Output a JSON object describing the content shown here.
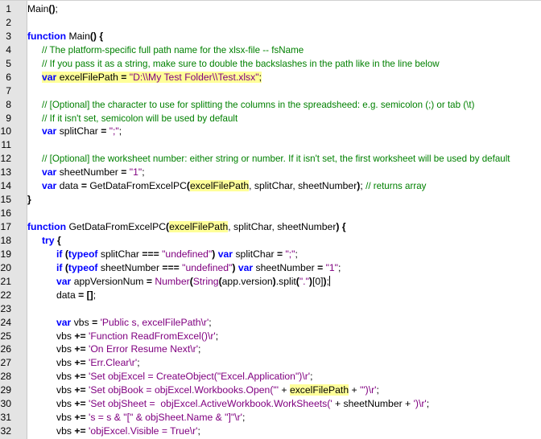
{
  "lines": [
    {
      "n": "1",
      "ind": 0,
      "t": [
        [
          "Main",
          "p"
        ],
        [
          "()",
          "o"
        ],
        [
          ";",
          "p"
        ]
      ]
    },
    {
      "n": "2",
      "ind": 0,
      "t": []
    },
    {
      "n": "3",
      "ind": 0,
      "t": [
        [
          "function",
          "k"
        ],
        [
          " Main",
          "p"
        ],
        [
          "()",
          "o"
        ],
        [
          " {",
          "o"
        ]
      ]
    },
    {
      "n": "4",
      "ind": 1,
      "t": [
        [
          "// The platform-specific full path name for the xlsx-file -- fsName",
          "c"
        ]
      ]
    },
    {
      "n": "5",
      "ind": 1,
      "t": [
        [
          "// If you pass it as a string, make sure to double the backslashes in the path like in the line below",
          "c"
        ]
      ]
    },
    {
      "n": "6",
      "ind": 1,
      "hl": true,
      "t": [
        [
          "var",
          "k"
        ],
        [
          " excelFilePath ",
          "p"
        ],
        [
          "=",
          "o"
        ],
        [
          " ",
          "p"
        ],
        [
          "\"D:\\\\My Test Folder\\\\Test.xlsx\"",
          "s"
        ],
        [
          ";",
          "p"
        ]
      ]
    },
    {
      "n": "7",
      "ind": 0,
      "t": []
    },
    {
      "n": "8",
      "ind": 1,
      "t": [
        [
          "// [Optional] the character to use for splitting the columns in the spreadsheed: e.g. semicolon (;) or tab (\\t)",
          "c"
        ]
      ]
    },
    {
      "n": "9",
      "ind": 1,
      "t": [
        [
          "// If it isn't set, semicolon will be used by default",
          "c"
        ]
      ]
    },
    {
      "n": "10",
      "ind": 1,
      "t": [
        [
          "var",
          "k"
        ],
        [
          " splitChar ",
          "p"
        ],
        [
          "=",
          "o"
        ],
        [
          " ",
          "p"
        ],
        [
          "\";\"",
          "s"
        ],
        [
          ";",
          "p"
        ]
      ]
    },
    {
      "n": "11",
      "ind": 0,
      "t": []
    },
    {
      "n": "12",
      "ind": 1,
      "t": [
        [
          "// [Optional] the worksheet number: either string or number. If it isn't set, the first worksheet will be used by default",
          "c"
        ]
      ]
    },
    {
      "n": "13",
      "ind": 1,
      "t": [
        [
          "var",
          "k"
        ],
        [
          " sheetNumber ",
          "p"
        ],
        [
          "=",
          "o"
        ],
        [
          " ",
          "p"
        ],
        [
          "\"1\"",
          "s"
        ],
        [
          ";",
          "p"
        ]
      ]
    },
    {
      "n": "14",
      "ind": 1,
      "t": [
        [
          "var",
          "k"
        ],
        [
          " data ",
          "p"
        ],
        [
          "=",
          "o"
        ],
        [
          " GetDataFromExcelPC",
          "p"
        ],
        [
          "(",
          "o"
        ],
        [
          "excelFilePath",
          "h"
        ],
        [
          ", splitChar, sheetNumber",
          "p"
        ],
        [
          ")",
          "o"
        ],
        [
          "; ",
          "p"
        ],
        [
          "// returns array",
          "c"
        ]
      ]
    },
    {
      "n": "15",
      "ind": 0,
      "t": [
        [
          "}",
          "o"
        ]
      ]
    },
    {
      "n": "16",
      "ind": 0,
      "t": []
    },
    {
      "n": "17",
      "ind": 0,
      "t": [
        [
          "function",
          "k"
        ],
        [
          " GetDataFromExcelPC",
          "p"
        ],
        [
          "(",
          "o"
        ],
        [
          "excelFilePath",
          "h"
        ],
        [
          ", splitChar, sheetNumber",
          "p"
        ],
        [
          ")",
          "o"
        ],
        [
          " {",
          "o"
        ]
      ]
    },
    {
      "n": "18",
      "ind": 1,
      "t": [
        [
          "try",
          "k"
        ],
        [
          " {",
          "o"
        ]
      ]
    },
    {
      "n": "19",
      "ind": 2,
      "t": [
        [
          "if",
          "k"
        ],
        [
          " (",
          "o"
        ],
        [
          "typeof",
          "k"
        ],
        [
          " splitChar ",
          "p"
        ],
        [
          "===",
          "o"
        ],
        [
          " ",
          "p"
        ],
        [
          "\"undefined\"",
          "s"
        ],
        [
          ")",
          "o"
        ],
        [
          " ",
          "p"
        ],
        [
          "var",
          "k"
        ],
        [
          " splitChar ",
          "p"
        ],
        [
          "=",
          "o"
        ],
        [
          " ",
          "p"
        ],
        [
          "\";\"",
          "s"
        ],
        [
          ";",
          "p"
        ]
      ]
    },
    {
      "n": "20",
      "ind": 2,
      "t": [
        [
          "if",
          "k"
        ],
        [
          " (",
          "o"
        ],
        [
          "typeof",
          "k"
        ],
        [
          " sheetNumber ",
          "p"
        ],
        [
          "===",
          "o"
        ],
        [
          " ",
          "p"
        ],
        [
          "\"undefined\"",
          "s"
        ],
        [
          ")",
          "o"
        ],
        [
          " ",
          "p"
        ],
        [
          "var",
          "k"
        ],
        [
          " sheetNumber ",
          "p"
        ],
        [
          "=",
          "o"
        ],
        [
          " ",
          "p"
        ],
        [
          "\"1\"",
          "s"
        ],
        [
          ";",
          "p"
        ]
      ]
    },
    {
      "n": "21",
      "ind": 2,
      "cursor": true,
      "t": [
        [
          "var",
          "k"
        ],
        [
          " appVersionNum ",
          "p"
        ],
        [
          "=",
          "o"
        ],
        [
          " ",
          "p"
        ],
        [
          "Number",
          "f"
        ],
        [
          "(",
          "o"
        ],
        [
          "String",
          "f"
        ],
        [
          "(",
          "o"
        ],
        [
          "app.version",
          "p"
        ],
        [
          ")",
          "o"
        ],
        [
          ".split",
          "p"
        ],
        [
          "(",
          "o"
        ],
        [
          "\".\"",
          "s"
        ],
        [
          ")",
          "o"
        ],
        [
          "[0]",
          "p"
        ],
        [
          ")",
          "o"
        ],
        [
          ";",
          "p"
        ]
      ]
    },
    {
      "n": "22",
      "ind": 2,
      "t": [
        [
          "data ",
          "p"
        ],
        [
          "=",
          "o"
        ],
        [
          " ",
          "p"
        ],
        [
          "[]",
          "o"
        ],
        [
          ";",
          "p"
        ]
      ]
    },
    {
      "n": "23",
      "ind": 0,
      "t": []
    },
    {
      "n": "24",
      "ind": 2,
      "t": [
        [
          "var",
          "k"
        ],
        [
          " vbs ",
          "p"
        ],
        [
          "=",
          "o"
        ],
        [
          " ",
          "p"
        ],
        [
          "'Public s, excelFilePath\\r'",
          "s"
        ],
        [
          ";",
          "p"
        ]
      ]
    },
    {
      "n": "25",
      "ind": 2,
      "t": [
        [
          "vbs ",
          "p"
        ],
        [
          "+=",
          "o"
        ],
        [
          " ",
          "p"
        ],
        [
          "'Function ReadFromExcel()\\r'",
          "s"
        ],
        [
          ";",
          "p"
        ]
      ]
    },
    {
      "n": "26",
      "ind": 2,
      "t": [
        [
          "vbs ",
          "p"
        ],
        [
          "+=",
          "o"
        ],
        [
          " ",
          "p"
        ],
        [
          "'On Error Resume Next\\r'",
          "s"
        ],
        [
          ";",
          "p"
        ]
      ]
    },
    {
      "n": "27",
      "ind": 2,
      "t": [
        [
          "vbs ",
          "p"
        ],
        [
          "+=",
          "o"
        ],
        [
          " ",
          "p"
        ],
        [
          "'Err.Clear\\r'",
          "s"
        ],
        [
          ";",
          "p"
        ]
      ]
    },
    {
      "n": "28",
      "ind": 2,
      "t": [
        [
          "vbs ",
          "p"
        ],
        [
          "+=",
          "o"
        ],
        [
          " ",
          "p"
        ],
        [
          "'Set objExcel = CreateObject(\"Excel.Application\")\\r'",
          "s"
        ],
        [
          ";",
          "p"
        ]
      ]
    },
    {
      "n": "29",
      "ind": 2,
      "t": [
        [
          "vbs ",
          "p"
        ],
        [
          "+=",
          "o"
        ],
        [
          " ",
          "p"
        ],
        [
          "'Set objBook = objExcel.Workbooks.Open(\"'",
          "s"
        ],
        [
          " + ",
          "p"
        ],
        [
          "excelFilePath",
          "h"
        ],
        [
          " + ",
          "p"
        ],
        [
          "'\")\\r'",
          "s"
        ],
        [
          ";",
          "p"
        ]
      ]
    },
    {
      "n": "30",
      "ind": 2,
      "t": [
        [
          "vbs ",
          "p"
        ],
        [
          "+=",
          "o"
        ],
        [
          " ",
          "p"
        ],
        [
          "'Set objSheet =  objExcel.ActiveWorkbook.WorkSheets('",
          "s"
        ],
        [
          " + sheetNumber + ",
          "p"
        ],
        [
          "')\\r'",
          "s"
        ],
        [
          ";",
          "p"
        ]
      ]
    },
    {
      "n": "31",
      "ind": 2,
      "t": [
        [
          "vbs ",
          "p"
        ],
        [
          "+=",
          "o"
        ],
        [
          " ",
          "p"
        ],
        [
          "'s = s & \"[\" & objSheet.Name & \"]\"\\r'",
          "s"
        ],
        [
          ";",
          "p"
        ]
      ]
    },
    {
      "n": "32",
      "ind": 2,
      "t": [
        [
          "vbs ",
          "p"
        ],
        [
          "+=",
          "o"
        ],
        [
          " ",
          "p"
        ],
        [
          "'objExcel.Visible = True\\r'",
          "s"
        ],
        [
          ";",
          "p"
        ]
      ]
    }
  ]
}
